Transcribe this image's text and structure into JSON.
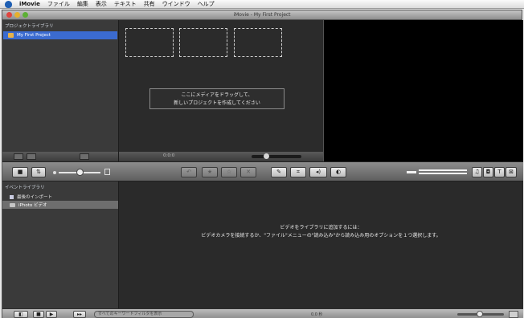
{
  "menubar": {
    "app_name": "iMovie",
    "items": [
      "ファイル",
      "編集",
      "表示",
      "テキスト",
      "共有",
      "ウインドウ",
      "ヘルプ"
    ]
  },
  "window": {
    "title": "iMovie - My First Project"
  },
  "project_library": {
    "title": "プロジェクトライブラリ",
    "items": [
      {
        "label": "My First Project",
        "selected": true
      }
    ]
  },
  "project_browser": {
    "drop_message_line1": "ここにメディアをドラッグして、",
    "drop_message_line2": "新しいプロジェクトを作成してください",
    "duration": "0:0:0"
  },
  "event_library": {
    "title": "イベントライブラリ",
    "items": [
      {
        "label": "最後のインポート",
        "icon": "event-icon",
        "selected": false
      },
      {
        "label": "iPhoto ビデオ",
        "icon": "camera-icon",
        "selected": true
      }
    ]
  },
  "event_browser": {
    "message_title": "ビデオをライブラリに追加するには：",
    "message_body": "ビデオカメラを接続するか、\"ファイル\"メニューの\"読み込み\"から読み込み用のオプションを１つ選択します。"
  },
  "toolbar": {
    "icons": [
      "camera-icon",
      "swap-icon",
      "zoom-slider",
      "undo-icon",
      "favorite-icon",
      "unmark-icon",
      "reject-icon",
      "keyword-icon",
      "crop-icon",
      "audio-icon",
      "adjust-icon",
      "music-icon",
      "photo-icon",
      "title-icon",
      "transition-icon"
    ]
  },
  "bottombar": {
    "search_placeholder": "すべてのキーワードフィルタを表示",
    "duration": "0.0 秒"
  },
  "colors": {
    "selection": "#3b6bd0",
    "window_bg": "#2a2a2a",
    "sidebar_bg": "#3a3a3a"
  }
}
